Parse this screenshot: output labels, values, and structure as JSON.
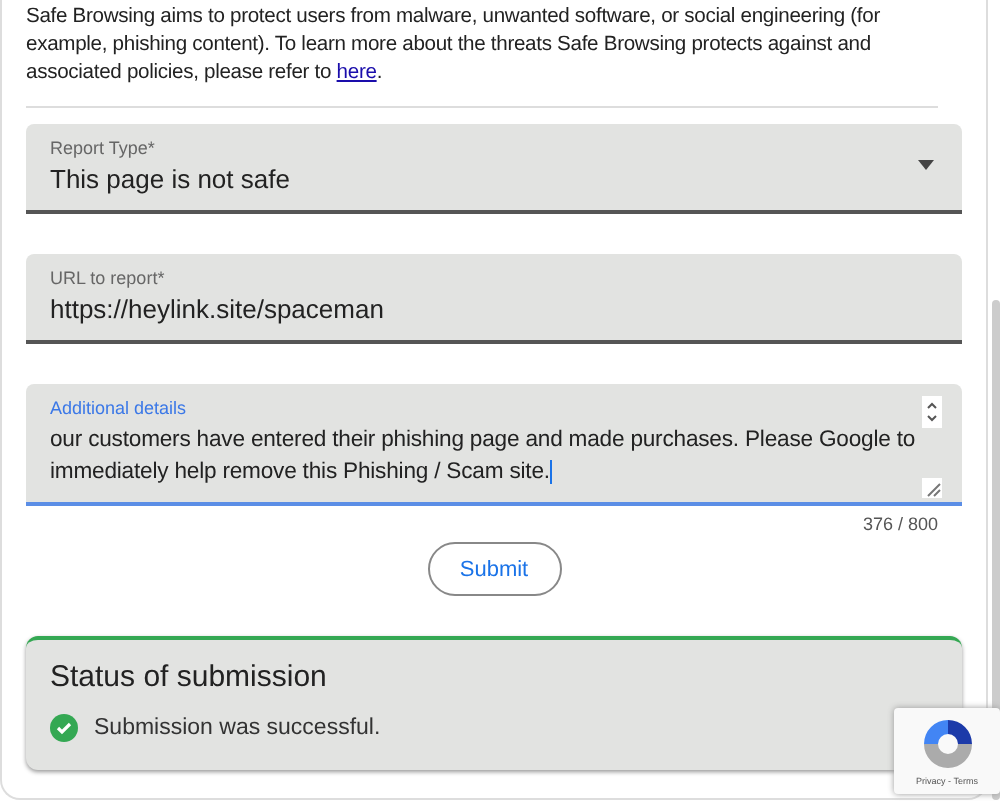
{
  "intro": {
    "text": "Safe Browsing aims to protect users from malware, unwanted software, or social engineering (for example, phishing content). To learn more about the threats Safe Browsing protects against and associated policies, please refer to ",
    "link": "here",
    "after": "."
  },
  "fields": [
    {
      "kind": "select",
      "label": "Report Type*",
      "value": "This page is not safe",
      "focused": false
    },
    {
      "kind": "text",
      "label": "URL to report*",
      "value": "https://heylink.site/spaceman",
      "focused": false
    },
    {
      "kind": "textarea",
      "label": "Additional details",
      "lines": [
        "our customers have entered their phishing page and made purchases. Please Google to",
        "immediately help remove this Phishing / Scam site."
      ],
      "focused": true,
      "counter": "376 / 800"
    }
  ],
  "submit": "Submit",
  "status": {
    "title": "Status of submission",
    "message": "Submission was successful.",
    "success": true
  },
  "recaptcha": {
    "links": "Privacy - Terms"
  }
}
